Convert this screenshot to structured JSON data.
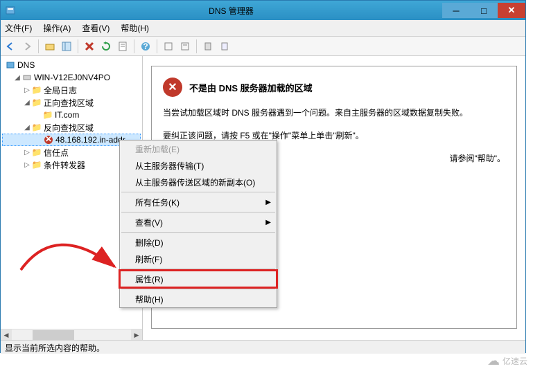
{
  "window": {
    "title": "DNS 管理器"
  },
  "menubar": {
    "file": "文件(F)",
    "action": "操作(A)",
    "view": "查看(V)",
    "help": "帮助(H)"
  },
  "tree": {
    "root": "DNS",
    "server": "WIN-V12EJ0NV4PO",
    "global_log": "全局日志",
    "forward_zone": "正向查找区域",
    "forward_item": "IT.com",
    "reverse_zone": "反向查找区域",
    "reverse_item": "48.168.192.in-addr",
    "trust_points": "信任点",
    "cond_forwarders": "条件转发器"
  },
  "detail": {
    "error_title": "不是由 DNS 服务器加载的区域",
    "error_line1": "当尝试加载区域时 DNS 服务器遇到一个问题。来自主服务器的区域数据复制失败。",
    "error_line2": "要纠正该问题，请按 F5 或在\"操作\"菜单上单击\"刷新\"。",
    "error_line3_vis": "请参阅\"帮助\"。"
  },
  "context_menu": {
    "reload": "重新加载(E)",
    "transfer": "从主服务器传输(T)",
    "new_copy": "从主服务器传送区域的新副本(O)",
    "all_tasks": "所有任务(K)",
    "view": "查看(V)",
    "delete": "删除(D)",
    "refresh": "刷新(F)",
    "properties": "属性(R)",
    "help": "帮助(H)"
  },
  "statusbar": {
    "text": "显示当前所选内容的帮助。"
  },
  "watermark": {
    "text": "亿速云"
  }
}
